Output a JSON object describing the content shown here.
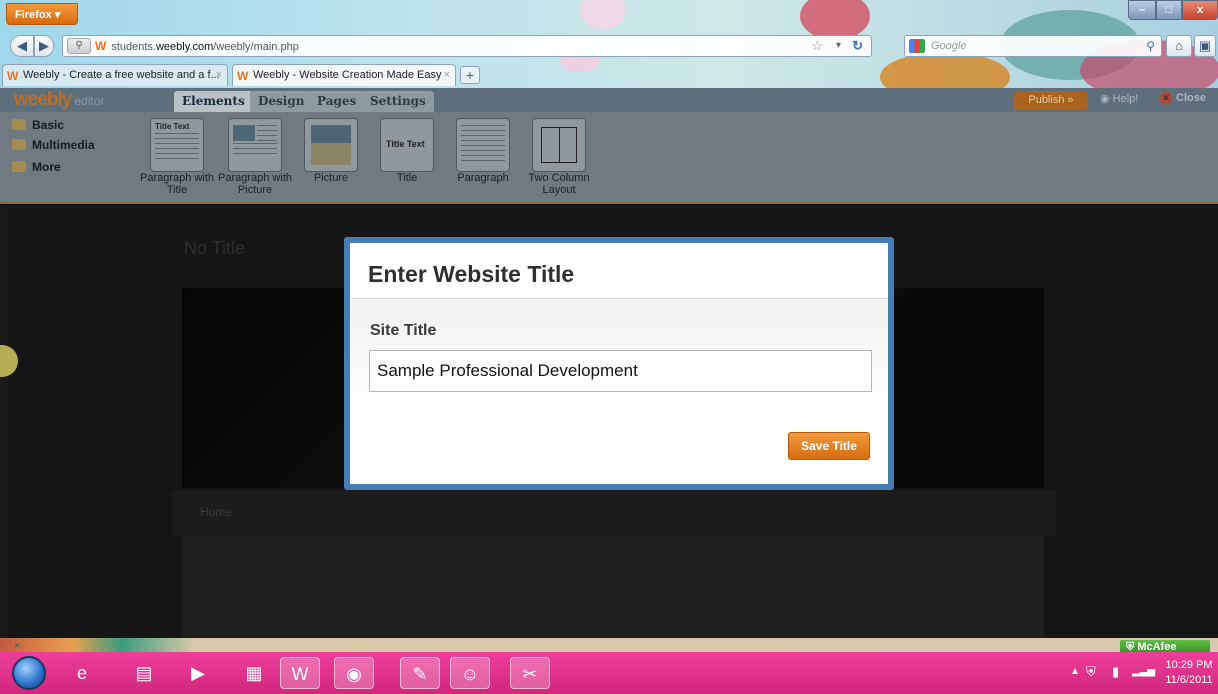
{
  "browser": {
    "menu_button": "Firefox",
    "url_prefix": "students.",
    "url_domain": "weebly.com",
    "url_path": "/weebly/main.php",
    "search_placeholder": "Google",
    "tabs": [
      {
        "label": "Weebly - Create a free website and a f...",
        "active": false
      },
      {
        "label": "Weebly - Website Creation Made Easy",
        "active": true
      }
    ],
    "new_tab_label": "+",
    "window_controls": {
      "minimize": "–",
      "maximize": "□",
      "close": "x"
    }
  },
  "editor": {
    "logo": "weebly",
    "logo_suffix": "editor",
    "tabs": [
      "Elements",
      "Design",
      "Pages",
      "Settings"
    ],
    "active_tab": "Elements",
    "publish_label": "Publish »",
    "help_label": "Help!",
    "close_label": "Close",
    "categories": [
      "Basic",
      "Multimedia",
      "More"
    ],
    "elements": [
      {
        "label": "Paragraph with Title",
        "thumb_title": "Title Text"
      },
      {
        "label": "Paragraph with Picture"
      },
      {
        "label": "Picture"
      },
      {
        "label": "Title",
        "thumb_title": "Title Text"
      },
      {
        "label": "Paragraph"
      },
      {
        "label": "Two Column Layout"
      }
    ]
  },
  "page": {
    "title": "No Title",
    "nav_item": "Home"
  },
  "modal": {
    "title": "Enter Website Title",
    "field_label": "Site Title",
    "field_value": "Sample Professional Development",
    "save_label": "Save Title"
  },
  "addon_bar": {
    "close": "×",
    "mcafee": "McAfee"
  },
  "taskbar": {
    "pinned": [
      "internet-explorer-icon",
      "windows-explorer-icon",
      "media-player-icon",
      "calculator-icon",
      "word-icon",
      "firefox-icon",
      "paint-icon",
      "messenger-icon",
      "snipping-tool-icon"
    ],
    "active": [
      "word-icon",
      "firefox-icon",
      "paint-icon",
      "messenger-icon",
      "snipping-tool-icon"
    ],
    "time": "10:29 PM",
    "date": "11/6/2011"
  },
  "colors": {
    "accent_orange": "#e8701a",
    "modal_border": "#4a7cb4",
    "taskbar": "#e33591"
  }
}
